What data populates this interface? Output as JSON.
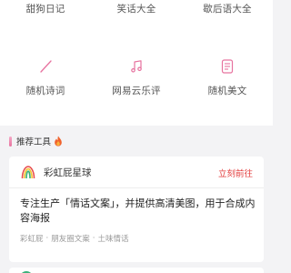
{
  "grid": {
    "row1": [
      {
        "label": "甜狗日记"
      },
      {
        "label": "笑话大全"
      },
      {
        "label": "歇后语大全"
      }
    ],
    "row2": [
      {
        "label": "随机诗词",
        "icon": "brush-icon"
      },
      {
        "label": "网易云乐评",
        "icon": "music-note-icon"
      },
      {
        "label": "随机美文",
        "icon": "document-icon"
      }
    ]
  },
  "section": {
    "title": "推荐工具",
    "icon": "fire-icon"
  },
  "tool": {
    "name": "彩虹屁星球",
    "action": "立刻前往",
    "description": "专注生产「情话文案」，并提供高清美图，用于合成内容海报",
    "tags": [
      "彩虹屁",
      "朋友圈文案",
      "土味情话"
    ],
    "tag_separator": "·"
  },
  "colors": {
    "accent_pink": "#e7739f",
    "action_red": "#e23b3b",
    "background": "#f3f3f5"
  }
}
